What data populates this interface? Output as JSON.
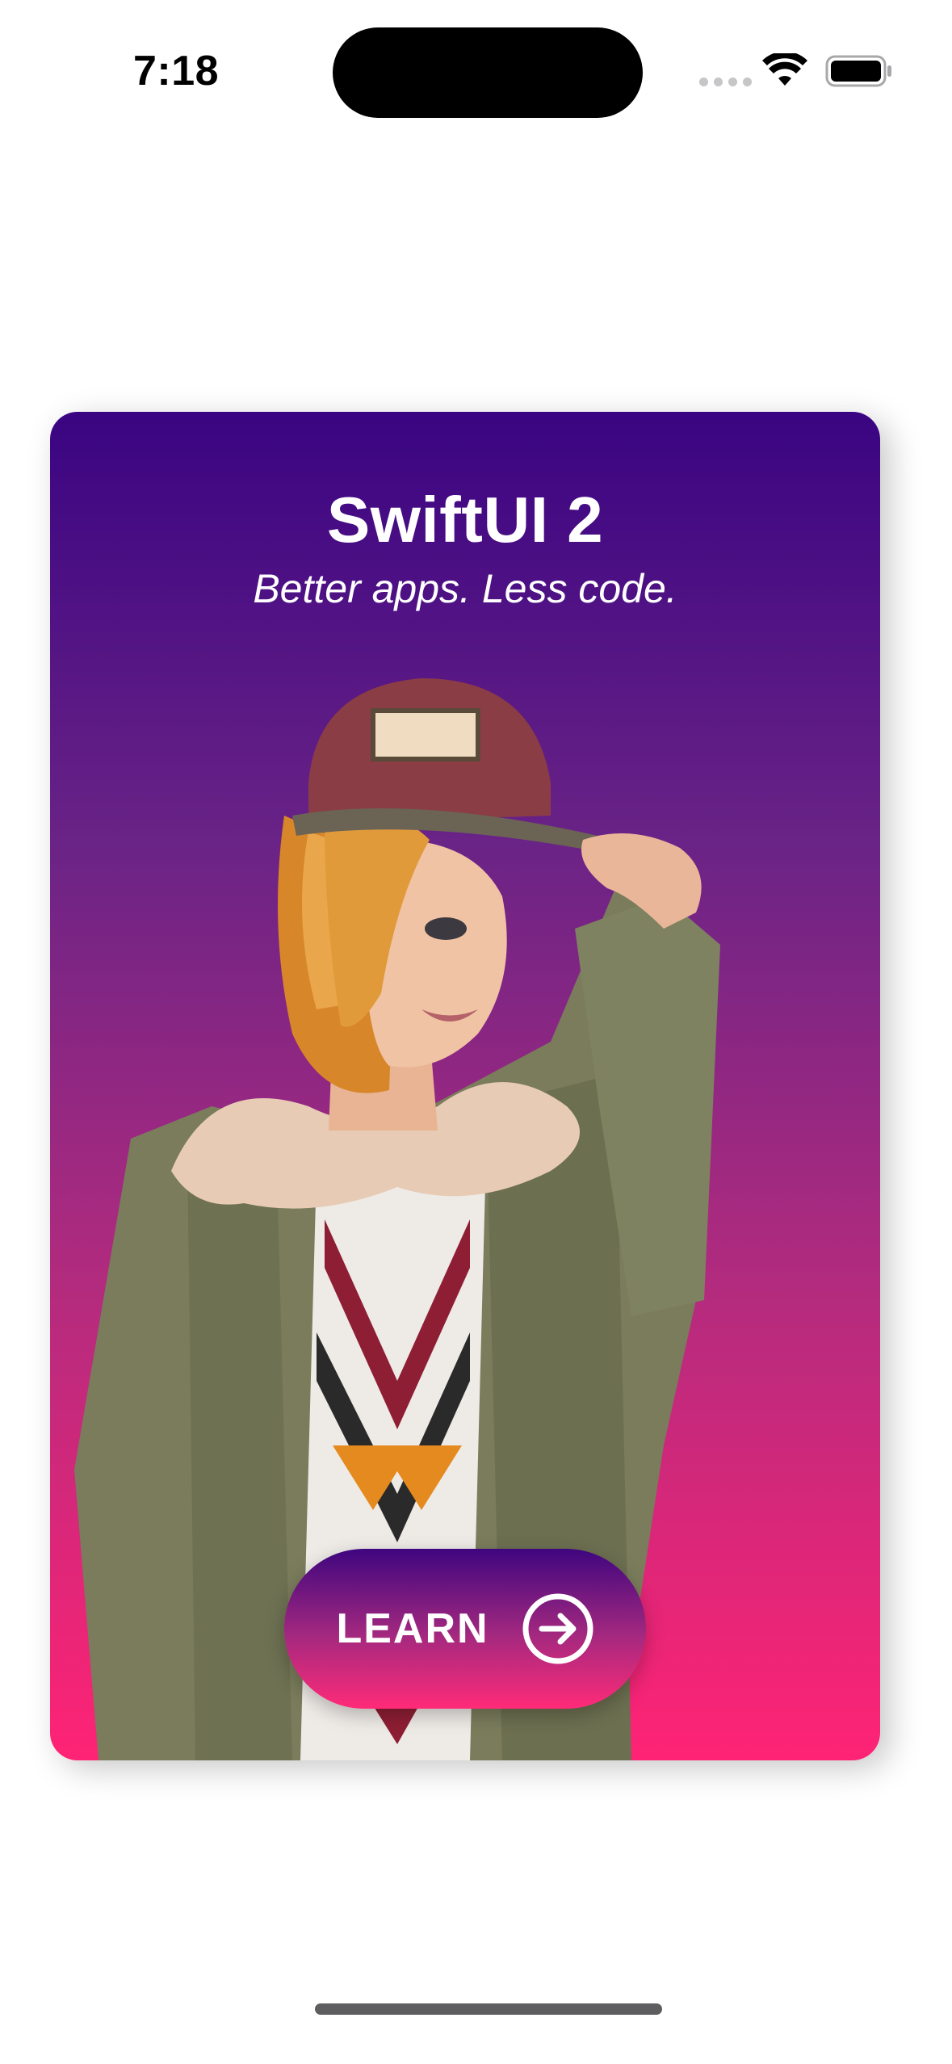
{
  "status_bar": {
    "time": "7:18"
  },
  "card": {
    "title": "SwiftUI 2",
    "subtitle": "Better apps. Less code.",
    "gradient_top": "#3a0482",
    "gradient_bottom": "#ff2375",
    "image": "woman-in-cap-and-green-jacket"
  },
  "learn_button": {
    "label": "LEARN",
    "icon": "arrow-right-circle-icon"
  }
}
